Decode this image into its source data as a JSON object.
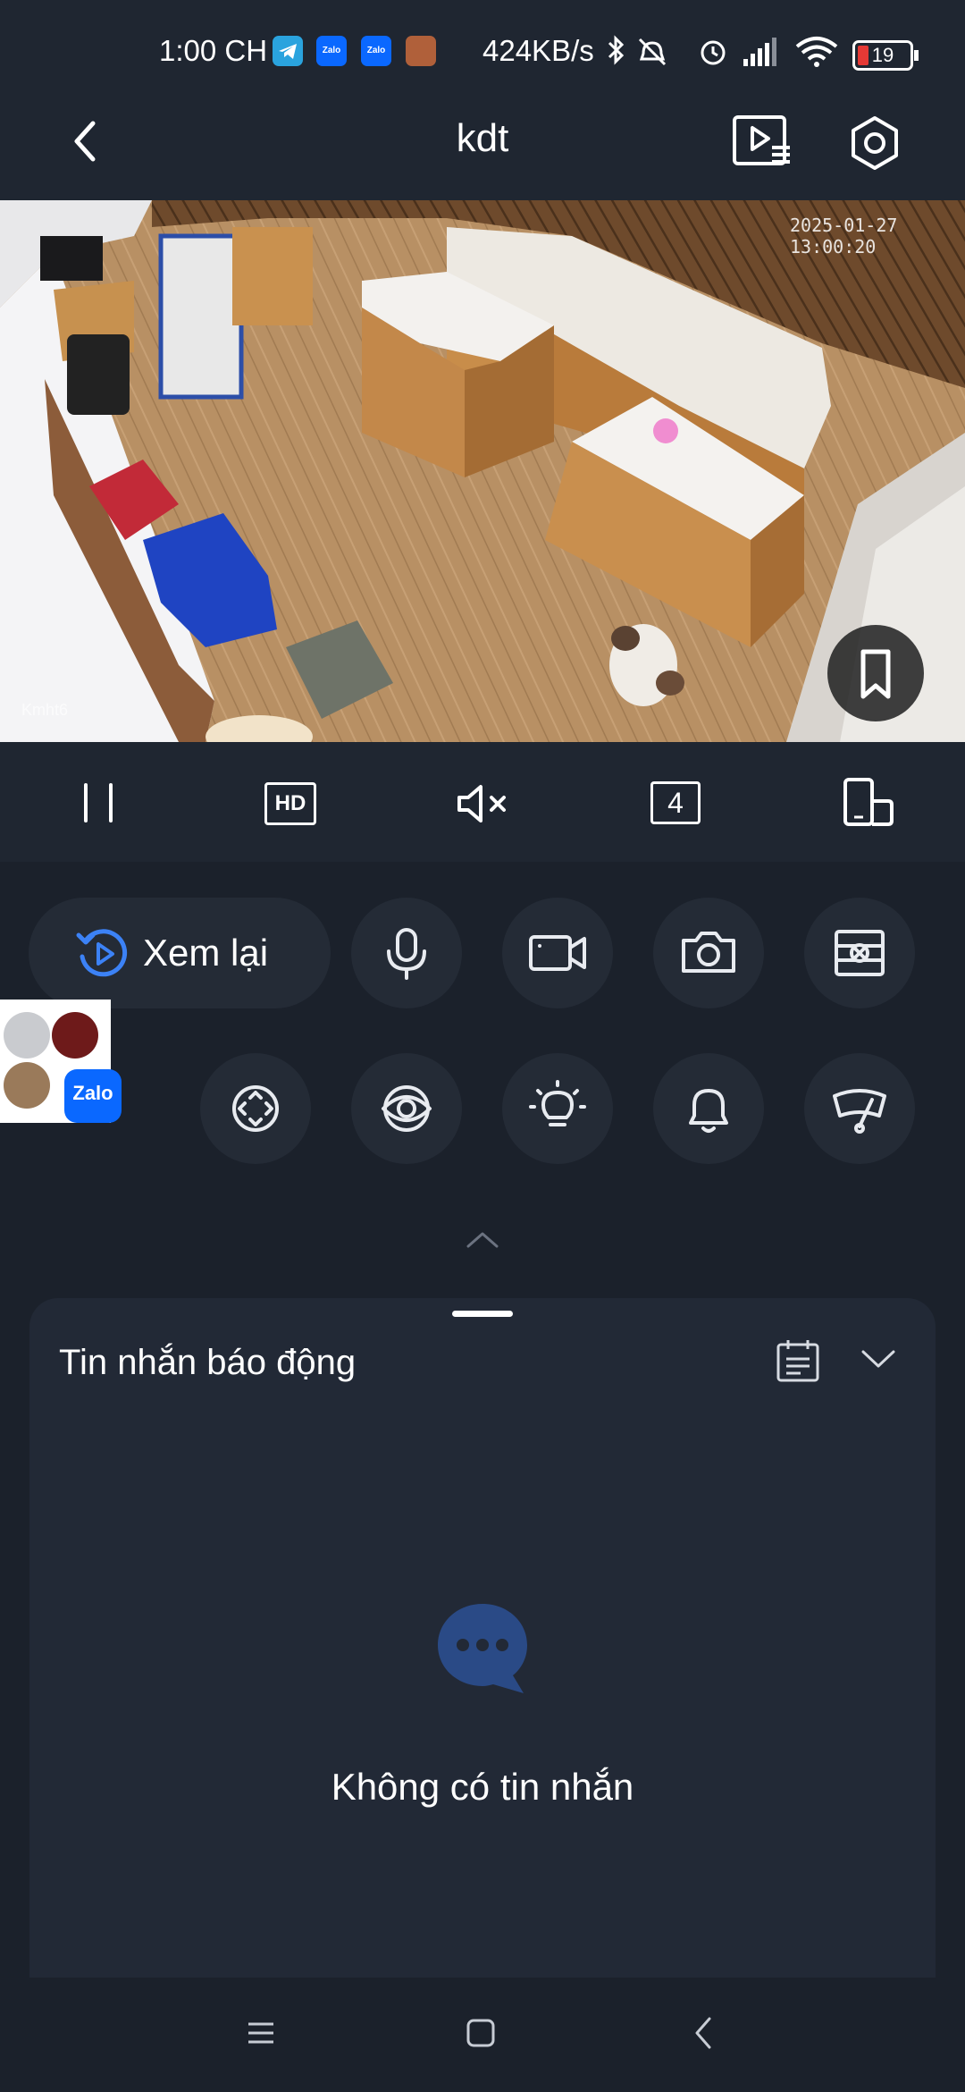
{
  "status_bar": {
    "time": "1:00 CH",
    "network_speed": "424KB/s",
    "battery": "19",
    "apps": [
      {
        "name": "telegram-icon",
        "color": "#2aa3de",
        "label": ""
      },
      {
        "name": "zalo-icon",
        "color": "#0a68ff",
        "label": "Zalo"
      },
      {
        "name": "zalo-icon",
        "color": "#0a68ff",
        "label": "Zalo"
      },
      {
        "name": "game-icon",
        "color": "#b0603a",
        "label": ""
      }
    ]
  },
  "header": {
    "title": "kdt",
    "icons": [
      "back-icon",
      "playback-list-icon",
      "settings-icon"
    ]
  },
  "camera": {
    "timestamp": "2025-01-27 13:00:20",
    "watermark": "Kmht6"
  },
  "toolbar": {
    "hd_label": "HD",
    "split_count": "4",
    "icons": [
      "pause-icon",
      "hd-icon",
      "mute-icon",
      "split-screen-icon",
      "rotate-screen-icon"
    ]
  },
  "controls": {
    "replay_label": "Xem lại",
    "row1_icons": [
      "replay-icon",
      "microphone-icon",
      "record-video-icon",
      "snapshot-icon",
      "fisheye-icon"
    ],
    "row2_icons": [
      "ptz-icon",
      "privacy-eye-icon",
      "light-icon",
      "alarm-bell-icon",
      "wiper-icon"
    ]
  },
  "floating_bubble": {
    "label": "Zalo",
    "color": "#0a68ff"
  },
  "alarm_panel": {
    "title": "Tin nhắn báo động",
    "empty_text": "Không có tin nhắn"
  },
  "colors": {
    "background": "#1b212b",
    "panel": "#222936",
    "accent": "#3c82f6",
    "empty_icon": "#2a4a86"
  }
}
